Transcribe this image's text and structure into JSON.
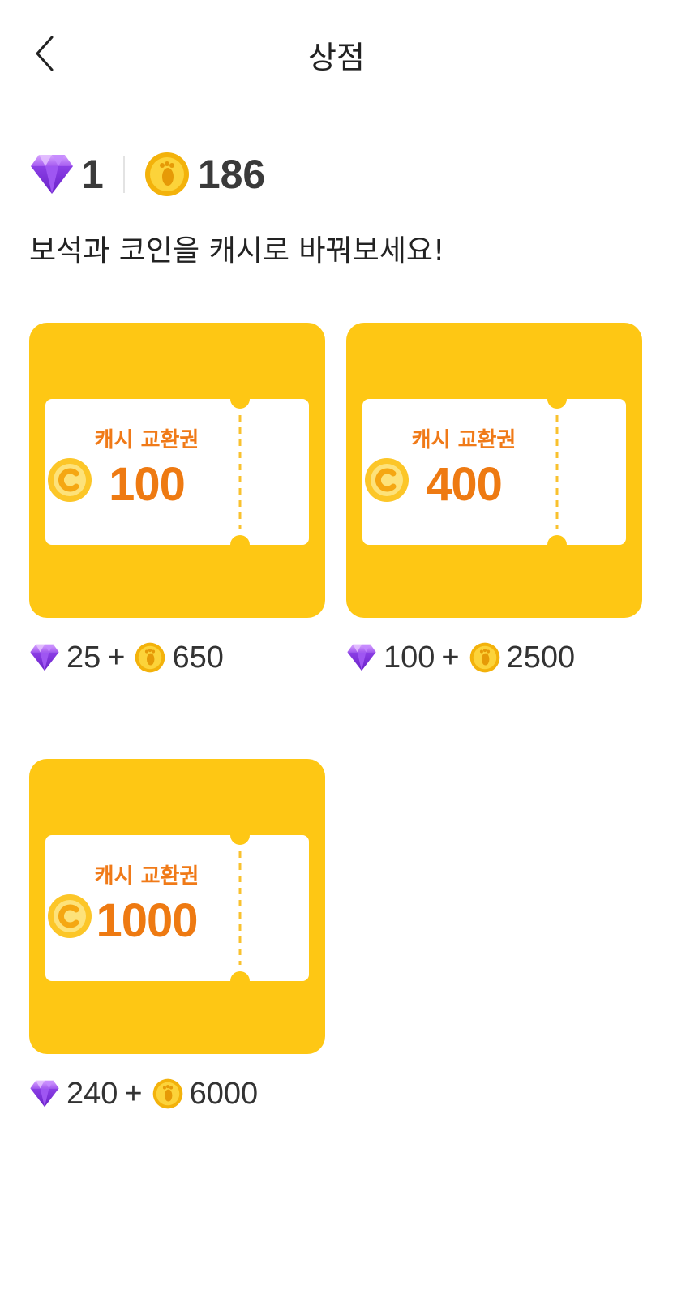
{
  "header": {
    "title": "상점"
  },
  "balance": {
    "gems": "1",
    "coins": "186"
  },
  "subtitle": "보석과 코인을 캐시로 바꿔보세요!",
  "ticket_label": "캐시 교환권",
  "products": [
    {
      "amount": "100",
      "gem_price": "25",
      "coin_price": "650"
    },
    {
      "amount": "400",
      "gem_price": "100",
      "coin_price": "2500"
    },
    {
      "amount": "1000",
      "gem_price": "240",
      "coin_price": "6000"
    }
  ],
  "plus": "+",
  "colors": {
    "card": "#fec714",
    "accent_orange": "#ee7a12",
    "gem": "#9b4dee",
    "coin": "#f6be0e"
  }
}
